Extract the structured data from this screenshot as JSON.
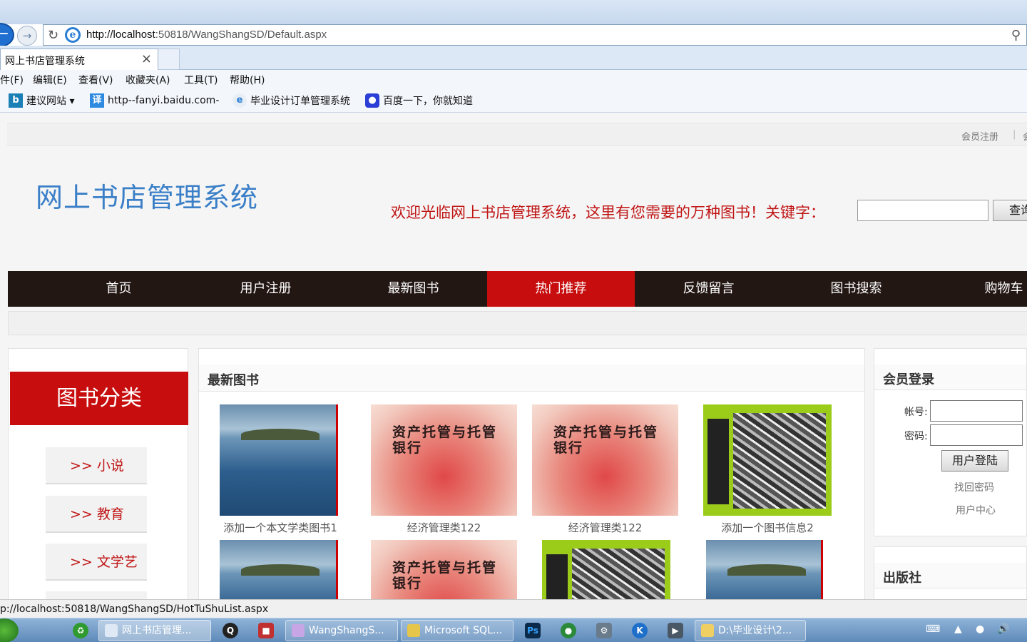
{
  "browser": {
    "url_host": "http://localhost",
    "url_rest": ":50818/WangShangSD/Default.aspx",
    "tab_title": "网上书店管理系统",
    "menu": [
      "件(F)",
      "编辑(E)",
      "查看(V)",
      "收藏夹(A)",
      "工具(T)",
      "帮助(H)"
    ],
    "favorites": [
      "建议网站 ▾",
      "http--fanyi.baidu.com-",
      "毕业设计订单管理系统",
      "百度一下，你就知道"
    ],
    "status_url": "p://localhost:50818/WangShangSD/HotTuShuList.aspx"
  },
  "site": {
    "top_links": [
      "会员注册",
      "|",
      "会"
    ],
    "title": "网上书店管理系统",
    "welcome": "欢迎光临网上书店管理系统，这里有您需要的万种图书！关键字：",
    "search_button": "查询",
    "nav": [
      "首页",
      "用户注册",
      "最新图书",
      "热门推荐",
      "反馈留言",
      "图书搜索",
      "购物车"
    ],
    "nav_active_index": 3
  },
  "categories": {
    "title": "图书分类",
    "items": [
      ">> 小说",
      ">> 教育",
      ">> 文学艺术"
    ]
  },
  "latest_books": {
    "title": "最新图书",
    "books": [
      {
        "caption": "添加一个本文学类图书1",
        "cover": "sea"
      },
      {
        "caption": "经济管理类122",
        "cover": "red",
        "cover_text": "资产托管与托管银行"
      },
      {
        "caption": "经济管理类122",
        "cover": "red",
        "cover_text": "资产托管与托管银行"
      },
      {
        "caption": "添加一个图书信息2",
        "cover": "green"
      }
    ],
    "second_row_covers": [
      "sea",
      "red",
      "green",
      "sea"
    ],
    "cover_text": "资产托管与托管银行"
  },
  "login": {
    "title": "会员登录",
    "account_label": "帐号:",
    "password_label": "密码:",
    "login_button": "用户登陆",
    "forgot": "找回密码",
    "user_center": "用户中心"
  },
  "publisher": {
    "title": "出版社"
  },
  "taskbar": {
    "buttons": [
      "网上书店管理...",
      "WangShangS...",
      "Microsoft SQL...",
      "D:\\毕业设计\\2..."
    ]
  },
  "colors": {
    "accent_red": "#c70d0d",
    "nav_dark": "#231714",
    "title_blue": "#3a7fc7"
  }
}
